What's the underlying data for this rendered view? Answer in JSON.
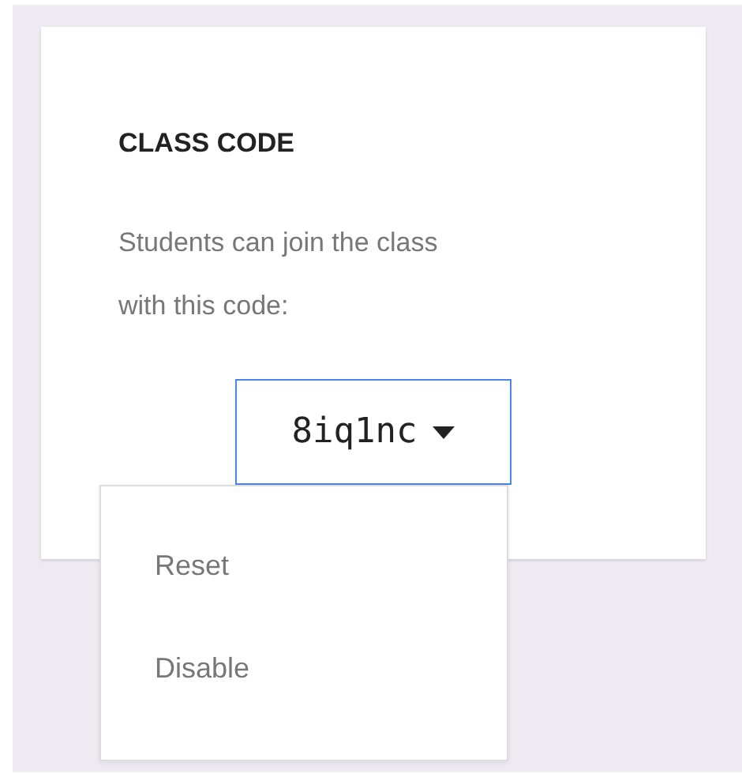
{
  "card": {
    "title": "CLASS CODE",
    "description": "Students can join the class with this code:",
    "code": "8iq1nc"
  },
  "menu": {
    "expanded": true,
    "items": [
      {
        "label": "Reset"
      },
      {
        "label": "Disable"
      }
    ]
  }
}
